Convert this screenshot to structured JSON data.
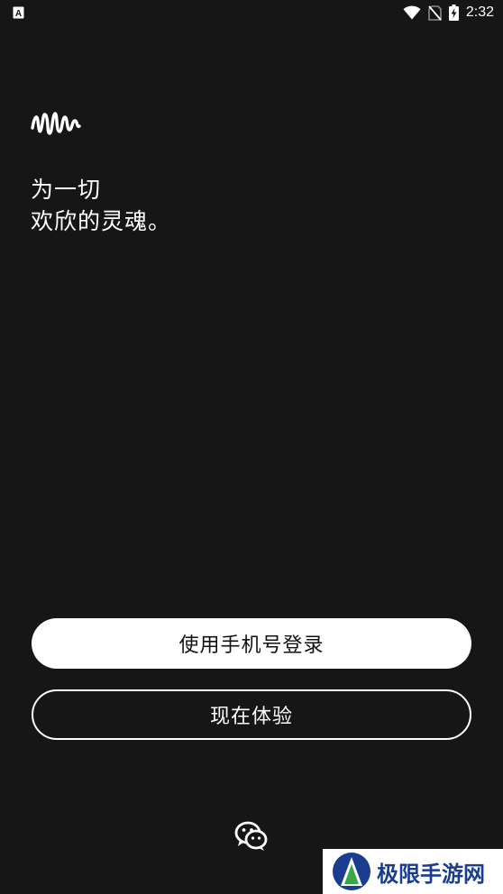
{
  "status_bar": {
    "time": "2:32",
    "left_icon": "keyboard-a-icon",
    "icons": [
      "wifi-icon",
      "no-sim-icon",
      "battery-charging-icon"
    ]
  },
  "logo": {
    "icon": "soundwave-logo-icon"
  },
  "tagline": {
    "line1": "为一切",
    "line2": "欢欣的灵魂。"
  },
  "buttons": {
    "phone_login": "使用手机号登录",
    "try_now": "现在体验"
  },
  "wechat": {
    "icon": "wechat-icon"
  },
  "watermark": {
    "text": "极限手游网"
  },
  "colors": {
    "background": "#161616",
    "primary_button_bg": "#ffffff",
    "primary_button_text": "#111111",
    "watermark_text": "#1a3d8f"
  }
}
